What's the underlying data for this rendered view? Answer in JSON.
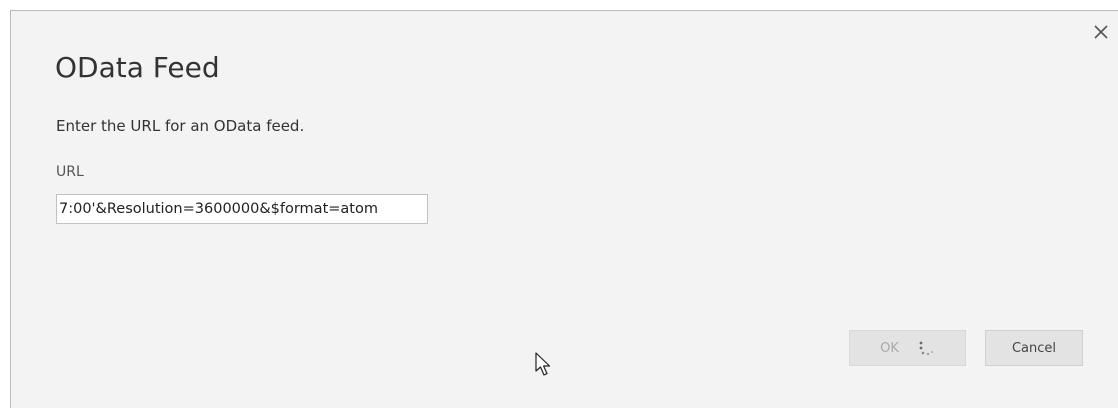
{
  "dialog": {
    "title": "OData Feed",
    "instructions": "Enter the URL for an OData feed.",
    "url_label": "URL",
    "url_value": "7:00'&Resolution=3600000&$format=atom",
    "close_glyph": "×"
  },
  "buttons": {
    "ok_label": "OK",
    "cancel_label": "Cancel"
  },
  "state": {
    "ok_loading": true
  },
  "icons": {
    "close": "close-icon",
    "spinner": "loading-spinner-icon",
    "cursor": "mouse-pointer-icon"
  },
  "colors": {
    "dialog_background": "#f3f3f3",
    "button_background": "#e3e3e3",
    "text": "#333333",
    "disabled_text": "#a8a8a8"
  }
}
